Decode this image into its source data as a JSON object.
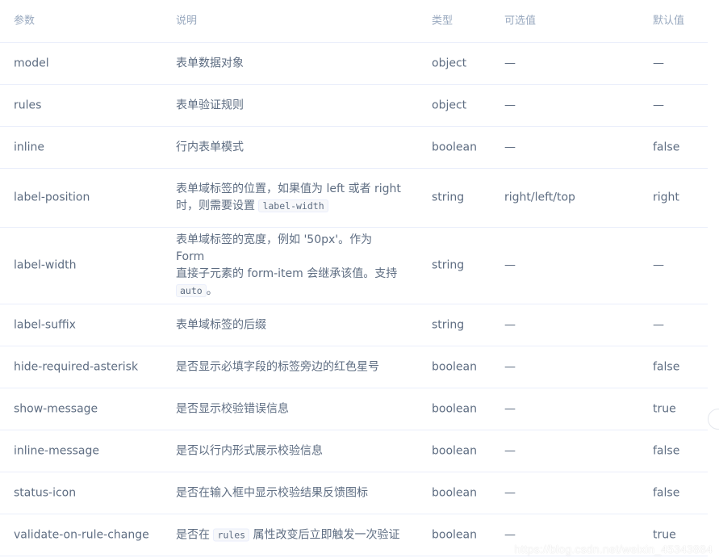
{
  "header": [
    "参数",
    "说明",
    "类型",
    "可选值",
    "默认值"
  ],
  "rows": [
    {
      "param": "model",
      "desc": "表单数据对象",
      "type": "object",
      "options": "—",
      "default": "—"
    },
    {
      "param": "rules",
      "desc": "表单验证规则",
      "type": "object",
      "options": "—",
      "default": "—"
    },
    {
      "param": "inline",
      "desc": "行内表单模式",
      "type": "boolean",
      "options": "—",
      "default": "false"
    },
    {
      "param": "label-position",
      "desc_a": "表单域标签的位置，如果值为 left 或者 right",
      "desc_b": "时，则需要设置",
      "desc_code": "label-width",
      "type": "string",
      "options": "right/left/top",
      "default": "right"
    },
    {
      "param": "label-width",
      "desc_a": "表单域标签的宽度，例如 '50px'。作为 Form",
      "desc_b": "直接子元素的 form-item 会继承该值。支持",
      "desc_code": "auto",
      "desc_c": "。",
      "type": "string",
      "options": "—",
      "default": "—"
    },
    {
      "param": "label-suffix",
      "desc": "表单域标签的后缀",
      "type": "string",
      "options": "—",
      "default": "—"
    },
    {
      "param": "hide-required-asterisk",
      "desc": "是否显示必填字段的标签旁边的红色星号",
      "type": "boolean",
      "options": "—",
      "default": "false"
    },
    {
      "param": "show-message",
      "desc": "是否显示校验错误信息",
      "type": "boolean",
      "options": "—",
      "default": "true"
    },
    {
      "param": "inline-message",
      "desc": "是否以行内形式展示校验信息",
      "type": "boolean",
      "options": "—",
      "default": "false"
    },
    {
      "param": "status-icon",
      "desc": "是否在输入框中显示校验结果反馈图标",
      "type": "boolean",
      "options": "—",
      "default": "false"
    },
    {
      "param": "validate-on-rule-change",
      "desc_a": "是否在",
      "desc_code": "rules",
      "desc_b": "属性改变后立即触发一次验证",
      "type": "boolean",
      "options": "—",
      "default": "true"
    }
  ],
  "watermark": "https://blog.csdn.net/weixin_45343884"
}
